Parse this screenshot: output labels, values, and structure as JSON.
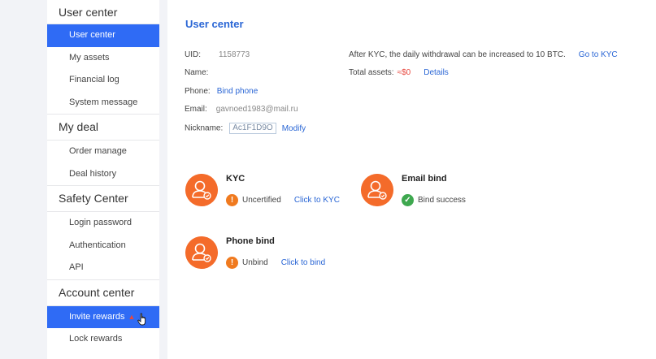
{
  "sidebar": {
    "sections": [
      {
        "title": "User center",
        "items": [
          "User center",
          "My assets",
          "Financial log",
          "System message"
        ]
      },
      {
        "title": "My deal",
        "items": [
          "Order manage",
          "Deal history"
        ]
      },
      {
        "title": "Safety Center",
        "items": [
          "Login password",
          "Authentication",
          "API"
        ]
      },
      {
        "title": "Account center",
        "items": [
          "Invite rewards",
          "Lock rewards"
        ]
      }
    ],
    "hot_icon": "flame-icon",
    "active_color": "#2f6bf5"
  },
  "main": {
    "title": "User center",
    "uid_label": "UID:",
    "uid_value": "1158773",
    "name_label": "Name:",
    "phone_label": "Phone:",
    "phone_link": "Bind phone",
    "email_label": "Email:",
    "email_value": "gavnoed1983@mail.ru",
    "nickname_label": "Nickname:",
    "nickname_value": "Ac1F1D9O",
    "modify_link": "Modify",
    "kyc_note": "After KYC, the daily withdrawal can be increased to 10 BTC.",
    "kyc_note_link": "Go to KYC",
    "total_assets_label": "Total assets:",
    "total_assets_value": "≈$0",
    "details_link": "Details"
  },
  "cards": {
    "kyc": {
      "title": "KYC",
      "status": "Uncertified",
      "action": "Click to KYC"
    },
    "email": {
      "title": "Email bind",
      "status": "Bind success"
    },
    "phone": {
      "title": "Phone bind",
      "status": "Unbind",
      "action": "Click to bind"
    }
  },
  "colors": {
    "accent": "#2a66d5",
    "avatar": "#f46b2a",
    "warn": "#f07a1f",
    "success": "#3ea84f",
    "red": "#e8483f"
  }
}
